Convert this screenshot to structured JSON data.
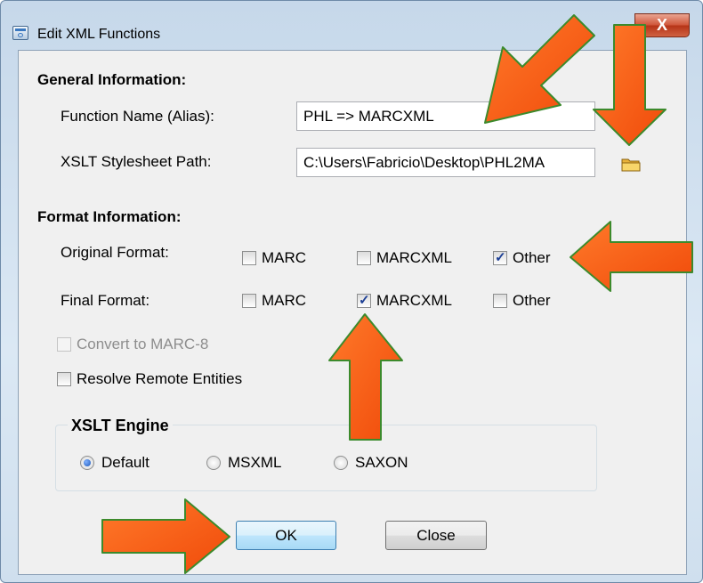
{
  "window": {
    "title": "Edit XML Functions",
    "close_glyph": "X"
  },
  "general": {
    "heading": "General Information:",
    "function_name_label": "Function Name (Alias):",
    "function_name_value": "PHL => MARCXML",
    "xslt_path_label": "XSLT Stylesheet Path:",
    "xslt_path_value": "C:\\Users\\Fabricio\\Desktop\\PHL2MA",
    "browse_icon": "folder-icon"
  },
  "format": {
    "heading": "Format Information:",
    "original_label": "Original Format:",
    "final_label": "Final Format:",
    "options": [
      "MARC",
      "MARCXML",
      "Other"
    ],
    "original_checked": [
      false,
      false,
      true
    ],
    "final_checked": [
      false,
      true,
      false
    ]
  },
  "options": {
    "convert_marc8": {
      "label": "Convert to MARC-8",
      "checked": false,
      "enabled": false
    },
    "resolve_entities": {
      "label": "Resolve Remote Entities",
      "checked": false,
      "enabled": true
    }
  },
  "engine": {
    "legend": "XSLT Engine",
    "choices": [
      "Default",
      "MSXML",
      "SAXON"
    ],
    "selected": "Default"
  },
  "buttons": {
    "ok": "OK",
    "close": "Close"
  },
  "annotation_color": "#ff5a14"
}
